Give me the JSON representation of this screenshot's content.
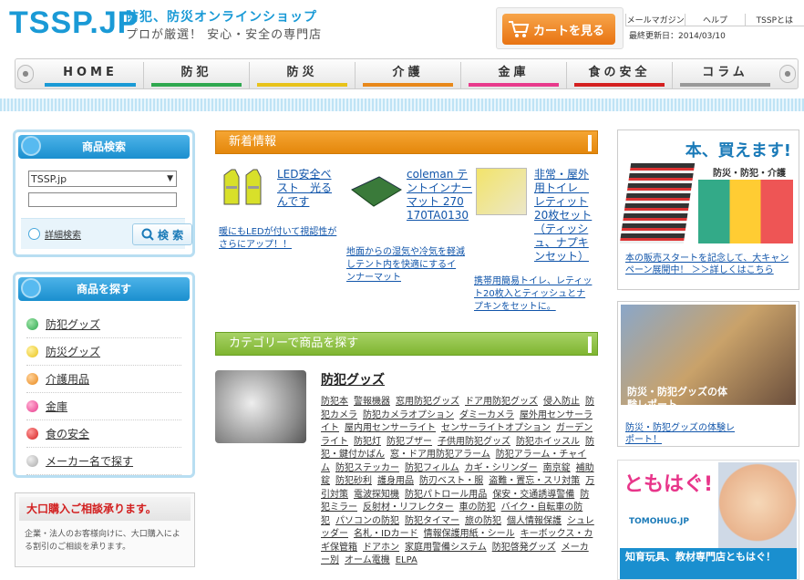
{
  "header": {
    "logo": "TSSP.JP",
    "tagline1": "防犯、防災オンラインショップ",
    "tagline2": "プロが厳選！ 安心・安全の専門店",
    "cart_label": "カートを見る",
    "toplinks": [
      "メールマガジン",
      "ヘルプ",
      "TSSPとは"
    ],
    "updated": "最終更新日：2014/03/10"
  },
  "nav": {
    "items": [
      {
        "label": "HOME",
        "color": "#1a9ad6"
      },
      {
        "label": "防犯",
        "color": "#2fa84f"
      },
      {
        "label": "防災",
        "color": "#e8c31a"
      },
      {
        "label": "介護",
        "color": "#e8881a"
      },
      {
        "label": "金庫",
        "color": "#e83a8c"
      },
      {
        "label": "食の安全",
        "color": "#d42020"
      },
      {
        "label": "コラム",
        "color": "#999999"
      }
    ]
  },
  "search": {
    "title": "商品検索",
    "select_value": "TSSP.jp",
    "detail_link": "詳細検索",
    "button": "検 索"
  },
  "categories": {
    "title": "商品を探す",
    "items": [
      {
        "label": "防犯グッズ",
        "color": "#2fa84f"
      },
      {
        "label": "防災グッズ",
        "color": "#e8c31a"
      },
      {
        "label": "介護用品",
        "color": "#e8881a"
      },
      {
        "label": "金庫",
        "color": "#e83a8c"
      },
      {
        "label": "食の安全",
        "color": "#d42020"
      },
      {
        "label": "メーカー名で探す",
        "color": "#bbbbbb"
      }
    ]
  },
  "bulk": {
    "title": "大口購入ご相談承ります。",
    "text": "企業・法人のお客様向けに、大口購入による割引のご相談を承ります。"
  },
  "news": {
    "title": "新着情報",
    "items": [
      {
        "title": "LED安全ベスト　光るんです",
        "desc": "暖にもLEDが付いて視認性がさらにアップ！！"
      },
      {
        "title": "coleman テントインナーマット 270 170TA0130",
        "desc": "地面からの湿気や冷気を軽減しテント内を快適にするインナーマット"
      },
      {
        "title": "非常・屋外用トイレ　レティット 20枚セット（ティッシュ、ナプキンセット）",
        "desc": "携帯用簡易トイレ、レティット20枚入とティッシュとナプキンをセットに。"
      }
    ]
  },
  "category_section": {
    "title": "カテゴリーで商品を探す",
    "product_title": "防犯グッズ",
    "tags": [
      "防犯本",
      "警報機器",
      "窓用防犯グッズ",
      "ドア用防犯グッズ",
      "侵入防止",
      "防犯カメラ",
      "防犯カメラオプション",
      "ダミーカメラ",
      "屋外用センサーライト",
      "屋内用センサーライト",
      "センサーライトオプション",
      "ガーデンライト",
      "防犯灯",
      "防犯ブザー",
      "子供用防犯グッズ",
      "防犯ホイッスル",
      "防犯・鍵付かばん",
      "窓・ドア用防犯アラーム",
      "防犯アラーム・チャイム",
      "防犯ステッカー",
      "防犯フィルム",
      "カギ・シリンダー",
      "南京錠",
      "補助錠",
      "防犯砂利",
      "護身用品",
      "防刃ベスト・服",
      "盗難・置忘・スリ対策",
      "万引対策",
      "電波探知機",
      "防犯パトロール用品",
      "保安・交通誘導警備",
      "防犯ミラー",
      "反射材・リフレクター",
      "車の防犯",
      "バイク・自転車の防犯",
      "パソコンの防犯",
      "防犯タイマー",
      "旅の防犯",
      "個人情報保護",
      "シュレッダー",
      "名札・IDカード",
      "情報保護用紙・シール",
      "キーボックス・カギ保管箱",
      "ドアホン",
      "家庭用警備システム",
      "防犯啓発グッズ",
      "メーカー別",
      "オーム電機",
      "ELPA"
    ]
  },
  "right": {
    "book_banner": "本、買えます!",
    "book_sub": "防災・防犯・介護",
    "book_link": "本の販売スタートを記念して、大キャンペーン展開中！ ＞＞詳しくはこちら",
    "report_banner": "防災・防犯グッズの体験レポート",
    "report_link": "防災・防犯グッズの体験レポート！",
    "tomo_title": "ともはぐ!",
    "tomo_domain": "TOMOHUG.JP",
    "tomo_sub": "知育玩具、教材専門店ともはぐ！"
  }
}
